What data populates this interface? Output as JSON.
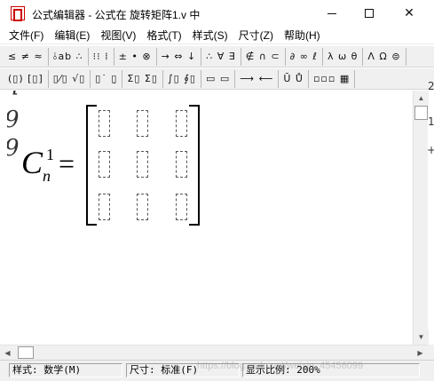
{
  "window": {
    "title": "公式编辑器 - 公式在 旋转矩阵1.v 中",
    "controls": {
      "minimize": "—",
      "maximize": "☐",
      "close": "✕"
    }
  },
  "menu": [
    "文件(F)",
    "编辑(E)",
    "视图(V)",
    "格式(T)",
    "样式(S)",
    "尺寸(Z)",
    "帮助(H)"
  ],
  "toolbar_row1": [
    "≤ ≠ ≈",
    "⫰ab ∴",
    "⁝⁝ ⁞",
    "± • ⊗",
    "→ ⇔ ↓",
    "∴ ∀ ∃",
    "∉ ∩ ⊂",
    "∂ ∞ ℓ",
    "λ ω θ",
    "Λ Ω ⊜"
  ],
  "toolbar_row2": [
    "(▯) [▯]",
    "▯⁄▯ √▯",
    "▯˙ ▯̣",
    "Σ▯ Σ▯",
    "∫▯ ∮▯",
    "▭ ▭",
    "⟶ ⟵",
    "Ū Ů",
    "▫▫▫ ▦"
  ],
  "equation": {
    "base": "C",
    "superscript": "1",
    "subscript": "n",
    "equals": "=",
    "matrix_rows": 3,
    "matrix_cols": 3
  },
  "left_clipped": [
    "q",
    "9",
    "9"
  ],
  "right_clipped": [
    "2",
    "1",
    "+"
  ],
  "status": {
    "style": "样式: 数学(M)",
    "size": "尺寸: 标准(F)",
    "zoom": "显示比例: 200%"
  },
  "watermark": "https://blog.csdn.net/weixin_45456099"
}
